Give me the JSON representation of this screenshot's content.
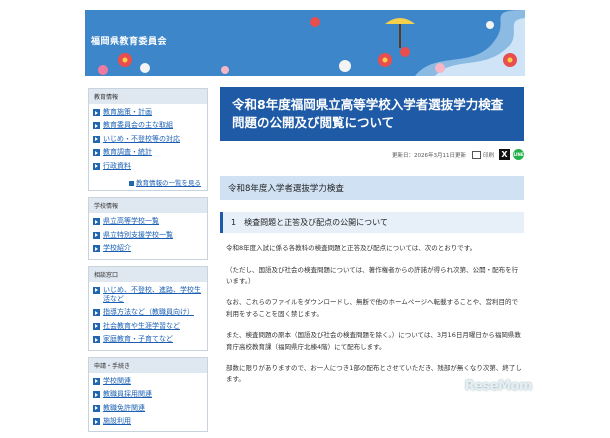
{
  "header": {
    "org_name": "福岡県教育委員会"
  },
  "sidebar": {
    "sections": [
      {
        "heading": "教育情報",
        "items": [
          "教育施策・計画",
          "教育委員会の主な取組",
          "いじめ・不登校等の対応",
          "教育調査・統計",
          "行政資料"
        ],
        "more": "教育情報の一覧を見る"
      },
      {
        "heading": "学校情報",
        "items": [
          "県立高等学校一覧",
          "県立特別支援学校一覧",
          "学校紹介"
        ]
      },
      {
        "heading": "相談窓口",
        "items": [
          "いじめ、不登校、進路、学校生活など",
          "指導方法など（教職員向け）",
          "社会教育や生涯学習など",
          "家庭教育・子育てなど"
        ]
      },
      {
        "heading": "申請・手続き",
        "items": [
          "学校関連",
          "教職員採用関連",
          "教職免許関連",
          "施設利用"
        ]
      }
    ]
  },
  "main": {
    "title": "令和8年度福岡県立高等学校入学者選抜学力検査問題の公開及び閲覧について",
    "updated": "更新日：2026年3月11日更新",
    "print_label": "印刷",
    "x_label": "X",
    "line_label": "LINE",
    "section_heading": "令和8年度入学者選抜学力検査",
    "subsection_heading": "1　検査問題と正答及び配点の公開について",
    "paragraphs": [
      "令和8年度入試に係る各教科の検査問題と正答及び配点については、次のとおりです。",
      "（ただし、国語及び社会の検査問題については、著作権者からの許諾が得られ次第、公開・配布を行います。）",
      "なお、これらのファイルをダウンロードし、無断で他のホームページへ転載することや、営利目的で利用をすることを固く禁じます。",
      "また、検査問題の原本（国語及び社会の検査問題を除く。）については、3月16日月曜日から福岡県教育庁高校教育課（福岡県庁北棟4階）にて配布します。",
      "部数に限りがありますので、お一人につき1部の配布とさせていただき、残部が無くなり次第、終了します。"
    ]
  },
  "watermark": "ReseMom"
}
